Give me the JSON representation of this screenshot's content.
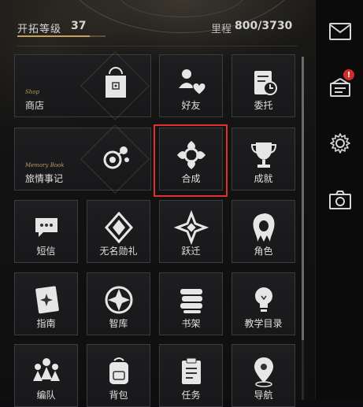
{
  "header": {
    "level_label": "开拓等级",
    "level_value": "37",
    "mileage_label": "里程",
    "mileage_value": "800/3730"
  },
  "menu": {
    "shop": {
      "label": "商店",
      "subtitle": "Shop"
    },
    "friends": {
      "label": "好友"
    },
    "commission": {
      "label": "委托"
    },
    "journal": {
      "label": "旅情事记",
      "subtitle": "Memory Book"
    },
    "synthesis": {
      "label": "合成"
    },
    "achievement": {
      "label": "成就"
    },
    "messages": {
      "label": "短信"
    },
    "reward": {
      "label": "无名勋礼"
    },
    "warp": {
      "label": "跃迁"
    },
    "character": {
      "label": "角色"
    },
    "guide": {
      "label": "指南"
    },
    "database": {
      "label": "智库"
    },
    "bookshelf": {
      "label": "书架"
    },
    "tutorial": {
      "label": "教学目录"
    },
    "team": {
      "label": "编队"
    },
    "inventory": {
      "label": "背包"
    },
    "missions": {
      "label": "任务"
    },
    "navigation": {
      "label": "导航"
    }
  },
  "sidebar": {
    "badge": "!"
  },
  "colors": {
    "accent": "#c8a25a",
    "highlight": "#e03131",
    "badge": "#d12c2c"
  }
}
